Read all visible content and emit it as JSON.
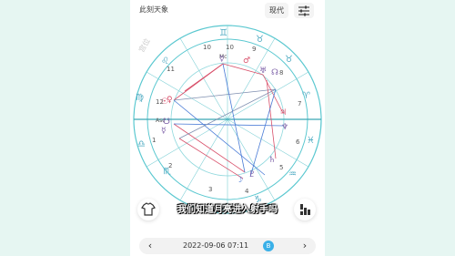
{
  "header": {
    "title": "此刻天象",
    "mode_label": "现代"
  },
  "chart": {
    "watermark": "宫位",
    "house_numbers": [
      "1",
      "2",
      "3",
      "4",
      "5",
      "6",
      "7",
      "8",
      "9",
      "10",
      "11",
      "12"
    ],
    "angle_labels": {
      "asc": "Asc",
      "mc": "Mc"
    },
    "colors": {
      "ring": "#5bc8d0",
      "planet": "#7b5ea7",
      "red_aspect": "#d8506a",
      "blue_aspect": "#4a7bd6"
    }
  },
  "subtitle": "我们知道月亮进入射手吗",
  "footer": {
    "prev_label": "‹",
    "next_label": "›",
    "datetime": "2022-09-06 07:11",
    "badge": "B"
  }
}
